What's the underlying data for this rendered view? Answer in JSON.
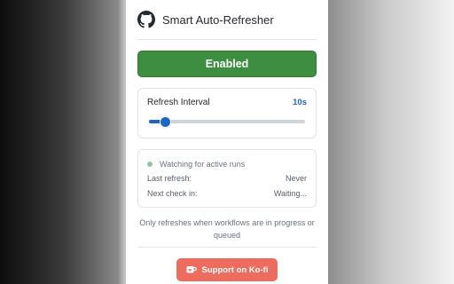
{
  "header": {
    "title": "Smart Auto-Refresher",
    "icon": "github-icon"
  },
  "toggle": {
    "label": "Enabled",
    "color": "#3e8e41"
  },
  "interval": {
    "label": "Refresh Interval",
    "value_label": "10s",
    "slider_fraction": 0.1,
    "accent": "#1a66c2"
  },
  "status": {
    "text": "Watching for active runs",
    "dot_color": "#8fc49a",
    "rows": [
      {
        "label": "Last refresh:",
        "value": "Never"
      },
      {
        "label": "Next check in:",
        "value": "Waiting..."
      }
    ]
  },
  "note": "Only refreshes when workflows are in progress or queued",
  "support": {
    "label": "Support on Ko-fi",
    "icon": "coffee-cup-icon",
    "color": "#ee6c5e"
  }
}
